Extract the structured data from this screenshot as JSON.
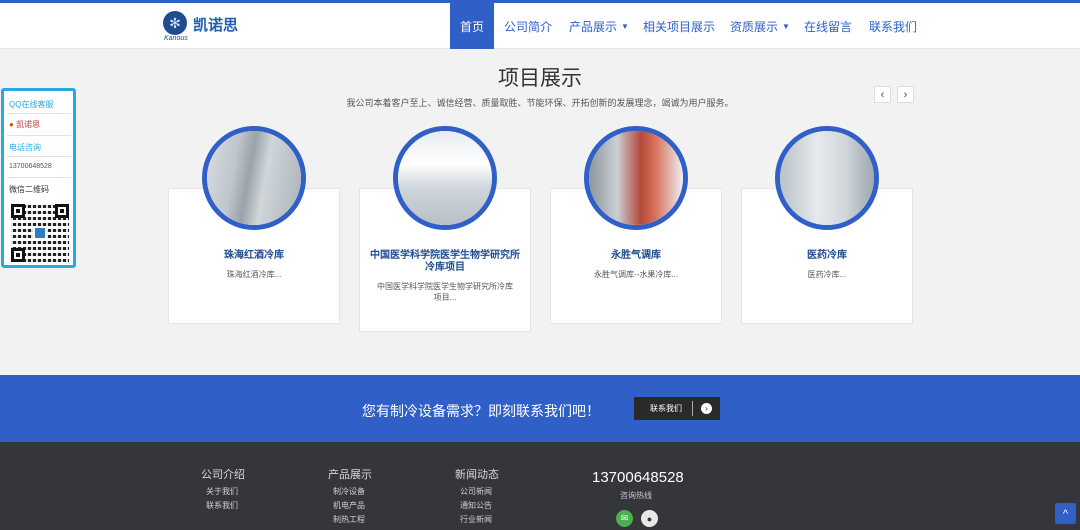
{
  "brand": {
    "name": "凯诺思",
    "sub": "Kanous",
    "accent": "#2f5fc7"
  },
  "nav": [
    {
      "label": "首页",
      "active": true
    },
    {
      "label": "公司简介"
    },
    {
      "label": "产品展示",
      "dropdown": true
    },
    {
      "label": "相关项目展示"
    },
    {
      "label": "资质展示",
      "dropdown": true
    },
    {
      "label": "在线留言"
    },
    {
      "label": "联系我们"
    }
  ],
  "section": {
    "title": "项目展示",
    "subtitle": "我公司本着客户至上、诚信经营、质量取胜、节能环保、开拓创新的发展理念，竭诚为用户服务。",
    "prev": "‹",
    "next": "›"
  },
  "projects": [
    {
      "title": "珠海红酒冷库",
      "desc": "珠海红酒冷库..."
    },
    {
      "title": "中国医学科学院医学生物学研究所冷库项目",
      "title_l1": "中国医学科学院医学生物学研究所",
      "title_l2": "冷库项目",
      "desc_l1": "中国医学科学院医学生物学研究所冷库",
      "desc_l2": "项目..."
    },
    {
      "title": "永胜气调库",
      "desc": "永胜气调库--水果冷库..."
    },
    {
      "title": "医药冷库",
      "desc": "医药冷库..."
    }
  ],
  "cta": {
    "text": "您有制冷设备需求？即刻联系我们吧！",
    "button": "联系我们",
    "icon": "›"
  },
  "footer": {
    "columns": [
      {
        "title": "公司介绍",
        "links": [
          "关于我们",
          "联系我们"
        ]
      },
      {
        "title": "产品展示",
        "links": [
          "制冷设备",
          "机电产品",
          "制热工程"
        ]
      },
      {
        "title": "新闻动态",
        "links": [
          "公司新闻",
          "通知公告",
          "行业新闻"
        ]
      }
    ],
    "hotline": "13700648528",
    "hotline_label": "咨询热线"
  },
  "qq_panel": {
    "qq_title": "QQ在线客服",
    "qq_name": "凯诺思",
    "phone_title": "电话咨询",
    "phone": "13700648528",
    "wechat_title": "微信二维码"
  },
  "back_to_top": "^"
}
